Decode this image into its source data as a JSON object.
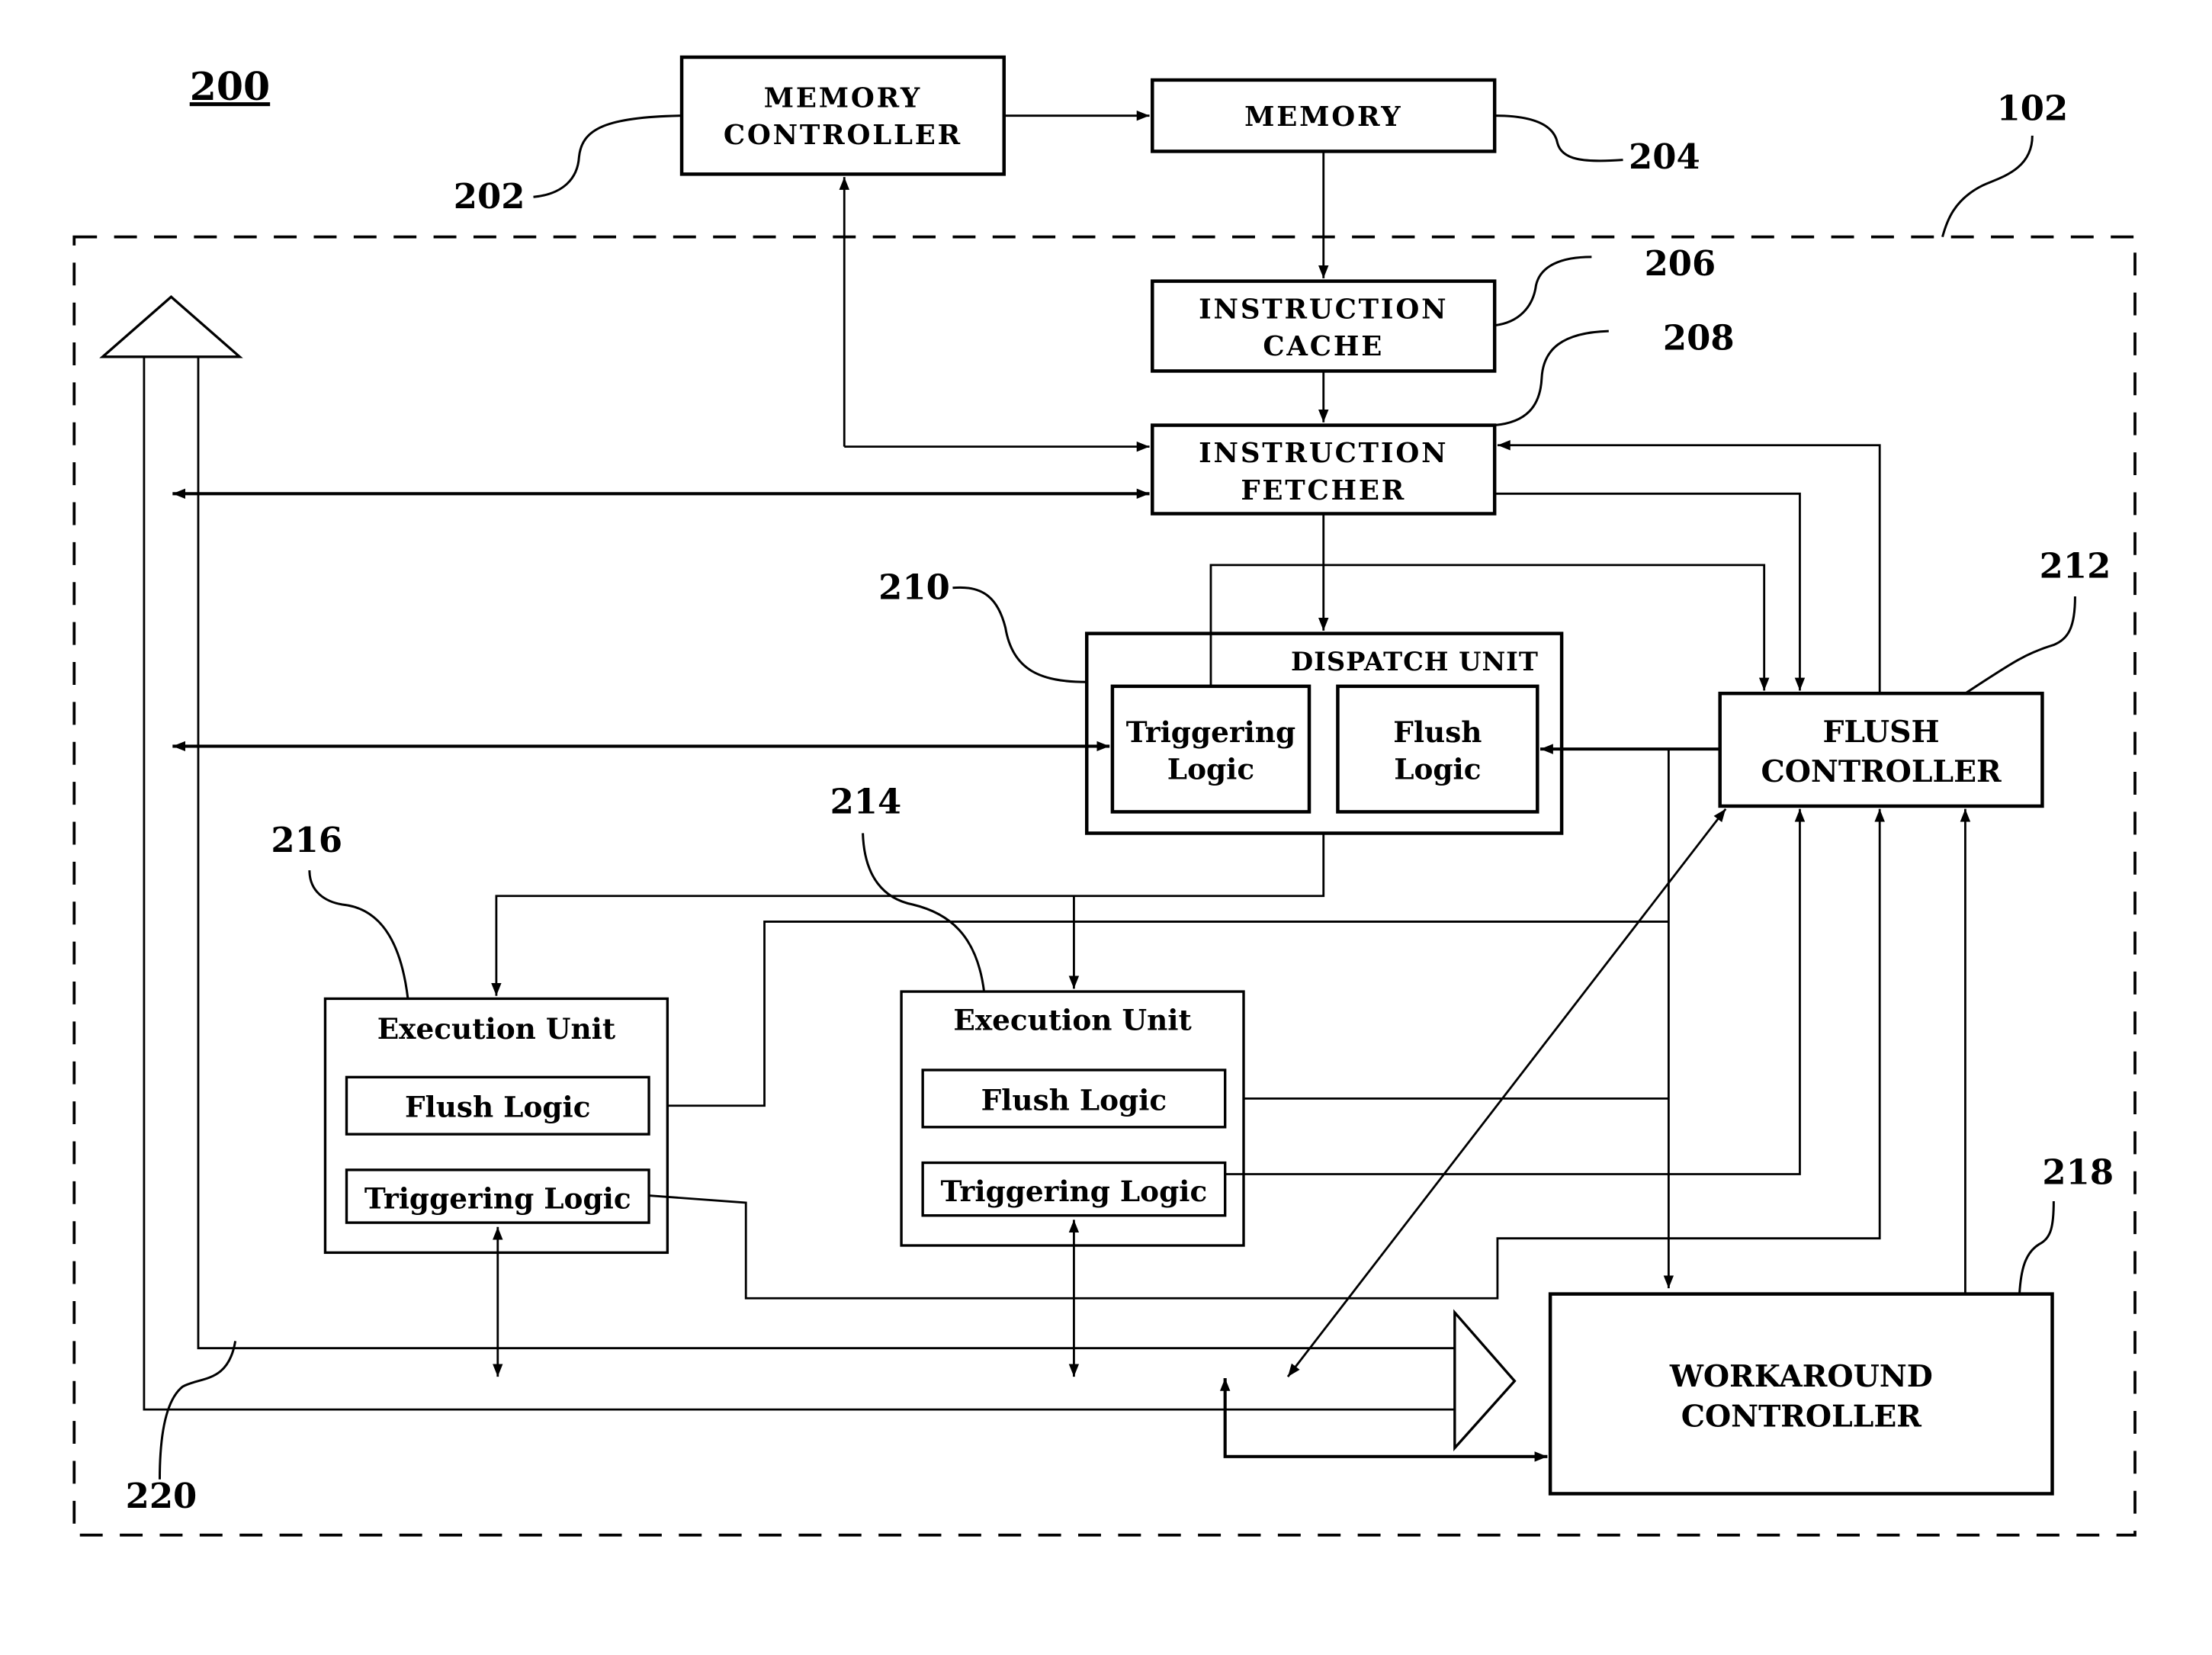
{
  "figure": {
    "number": "200",
    "boundary_ref": "102"
  },
  "blocks": {
    "memory_controller": {
      "ref": "202",
      "lines": [
        "MEMORY",
        "CONTROLLER"
      ]
    },
    "memory": {
      "ref": "204",
      "lines": [
        "MEMORY"
      ]
    },
    "instruction_cache": {
      "ref": "206",
      "lines": [
        "INSTRUCTION",
        "CACHE"
      ]
    },
    "instruction_fetcher": {
      "ref": "208",
      "lines": [
        "INSTRUCTION",
        "FETCHER"
      ]
    },
    "dispatch_unit": {
      "ref": "210",
      "title": "DISPATCH UNIT",
      "triggering_logic": [
        "Triggering",
        "Logic"
      ],
      "flush_logic": [
        "Flush",
        "Logic"
      ]
    },
    "flush_controller": {
      "ref": "212",
      "lines": [
        "FLUSH",
        "CONTROLLER"
      ]
    },
    "execution_unit_214": {
      "ref": "214",
      "title": "Execution Unit",
      "flush_logic": "Flush Logic",
      "triggering_logic": "Triggering Logic"
    },
    "execution_unit_216": {
      "ref": "216",
      "title": "Execution Unit",
      "flush_logic": "Flush Logic",
      "triggering_logic": "Triggering Logic"
    },
    "workaround_controller": {
      "ref": "218",
      "lines": [
        "WORKAROUND",
        "CONTROLLER"
      ]
    },
    "bus": {
      "ref": "220"
    }
  }
}
